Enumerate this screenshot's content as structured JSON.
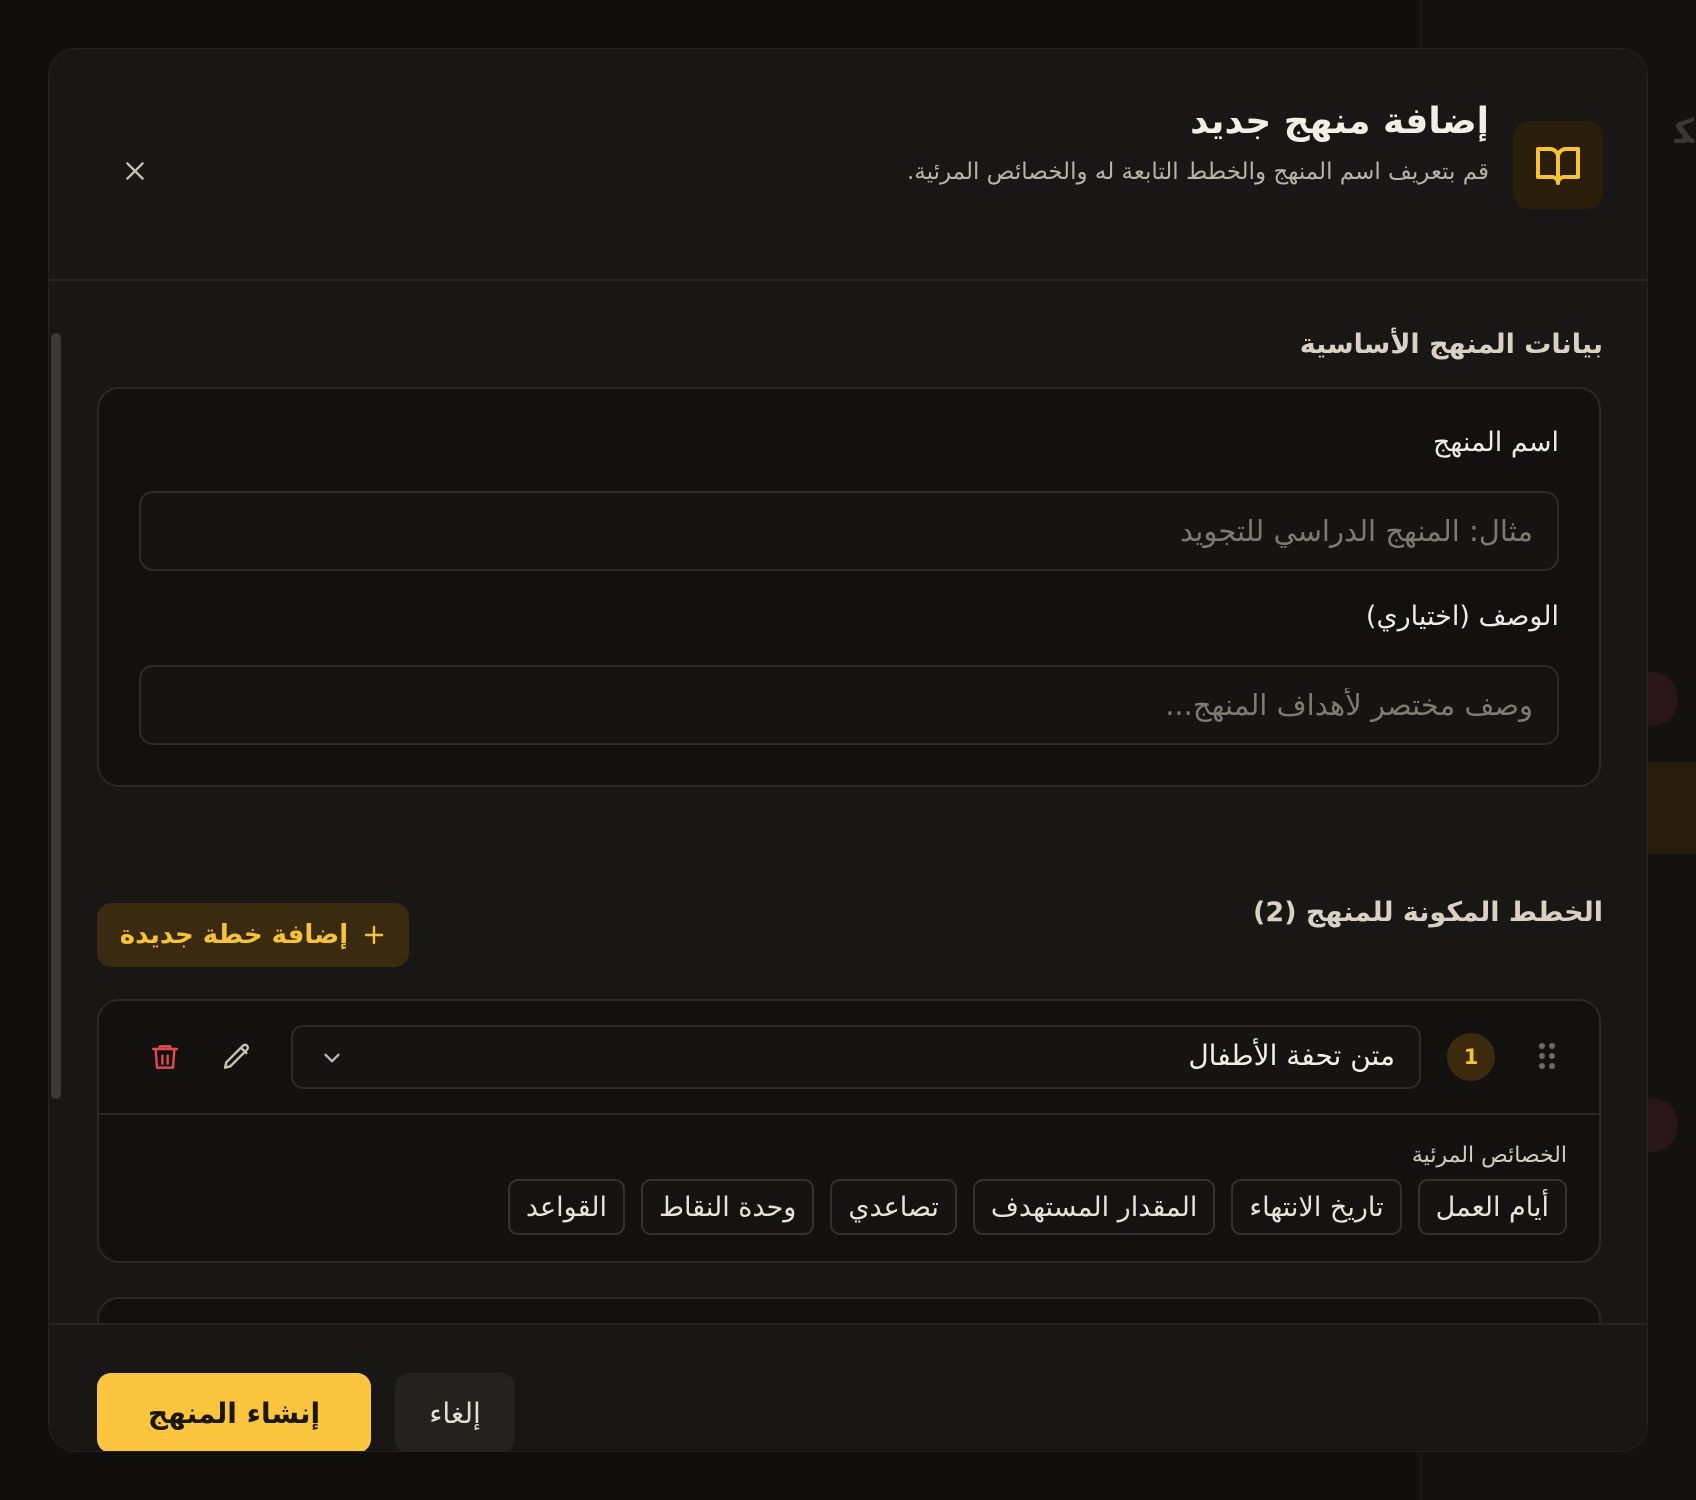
{
  "modal": {
    "title": "إضافة منهج جديد",
    "subtitle": "قم بتعريف اسم المنهج والخطط التابعة له والخصائص المرئية.",
    "header_icon": "book-open-icon",
    "close_icon": "close-icon"
  },
  "basic_info": {
    "section_title": "بيانات المنهج الأساسية",
    "name_label": "اسم المنهج",
    "name_placeholder": "مثال: المنهج الدراسي للتجويد",
    "name_value": "",
    "description_label": "الوصف (اختياري)",
    "description_placeholder": "وصف مختصر لأهداف المنهج...",
    "description_value": ""
  },
  "plans": {
    "section_title": "الخطط المكونة للمنهج (2)",
    "add_button_label": "إضافة خطة جديدة",
    "items": [
      {
        "number": "1",
        "selected": "متن تحفة الأطفال",
        "properties_label": "الخصائص المرئية",
        "properties": [
          "أيام العمل",
          "تاريخ الانتهاء",
          "المقدار المستهدف",
          "تصاعدي",
          "وحدة النقاط",
          "القواعد"
        ]
      }
    ]
  },
  "footer": {
    "create_label": "إنشاء المنهج",
    "cancel_label": "إلغاء"
  },
  "colors": {
    "accent": "#fcc540",
    "accent_text": "#f5c23a",
    "danger": "#e5484d",
    "surface": "#181715",
    "background": "#0f0e0c"
  }
}
